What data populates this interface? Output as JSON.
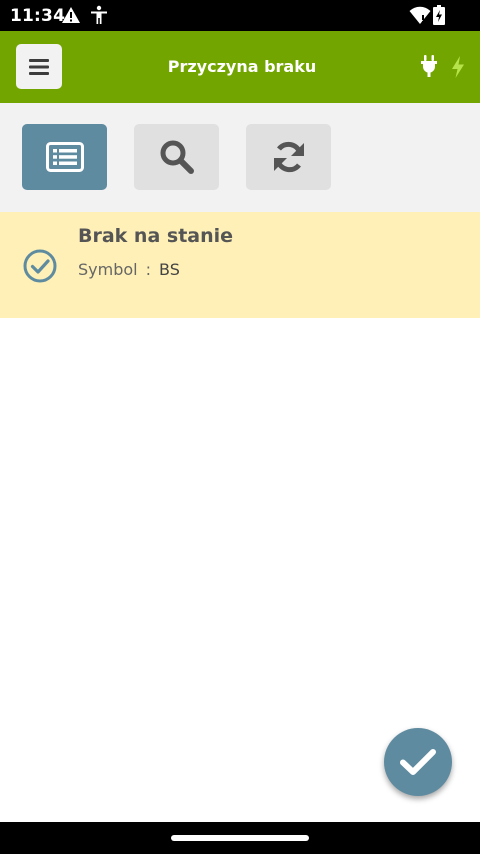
{
  "status_bar": {
    "time": "11:34",
    "icons": [
      "warning-icon",
      "accessibility-icon",
      "wifi-icon",
      "battery-charging-icon"
    ]
  },
  "header": {
    "title": "Przyczyna braku",
    "menu_icon": "hamburger-icon",
    "status_icons": [
      "plug-icon",
      "bolt-icon"
    ]
  },
  "toolbar": {
    "buttons": [
      {
        "icon": "list-icon",
        "active": true
      },
      {
        "icon": "search-icon",
        "active": false
      },
      {
        "icon": "refresh-icon",
        "active": false
      }
    ]
  },
  "items": [
    {
      "title": "Brak na stanie",
      "symbol_label": "Symbol",
      "separator": ":",
      "symbol_value": "BS",
      "selected": true
    }
  ],
  "fab": {
    "icon": "checkmark-icon"
  },
  "colors": {
    "header": "#73a500",
    "accent": "#5f8ba0",
    "selected_row": "#fef0b6",
    "toolbar_bg": "#f2f2f2"
  }
}
